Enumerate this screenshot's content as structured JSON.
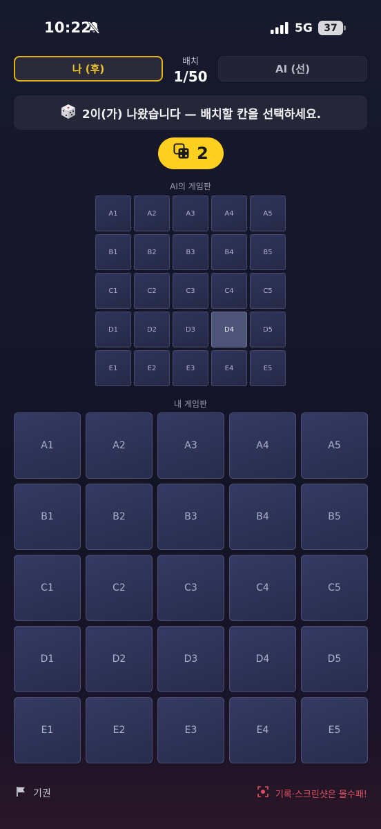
{
  "status_bar": {
    "time": "10:22",
    "network": "5G",
    "battery": "37",
    "icons": [
      "bell-slash-icon",
      "signal-icon"
    ]
  },
  "players": {
    "me": "나 (후)",
    "ai": "AI (선)"
  },
  "placement": {
    "label": "배치",
    "value": "1/50"
  },
  "message": "2이(가) 나왔습니다 — 배치할 칸을 선택하세요.",
  "dice": {
    "value": "2",
    "color": "#ffd01f",
    "icon": "dice-icon"
  },
  "ai_board": {
    "label": "AI의 게임판",
    "cells": [
      "A1",
      "A2",
      "A3",
      "A4",
      "A5",
      "B1",
      "B2",
      "B3",
      "B4",
      "B5",
      "C1",
      "C2",
      "C3",
      "C4",
      "C5",
      "D1",
      "D2",
      "D3",
      "D4",
      "D5",
      "E1",
      "E2",
      "E3",
      "E4",
      "E5"
    ],
    "highlighted": "D4"
  },
  "my_board": {
    "label": "내 게임판",
    "cells": [
      "A1",
      "A2",
      "A3",
      "A4",
      "A5",
      "B1",
      "B2",
      "B3",
      "B4",
      "B5",
      "C1",
      "C2",
      "C3",
      "C4",
      "C5",
      "D1",
      "D2",
      "D3",
      "D4",
      "D5",
      "E1",
      "E2",
      "E3",
      "E4",
      "E5"
    ]
  },
  "footer": {
    "forfeit": "기권",
    "warning": "기록·스크린샷은 몰수패!",
    "warning_color": "#e0505f",
    "accent_color": "#e0b31a"
  }
}
